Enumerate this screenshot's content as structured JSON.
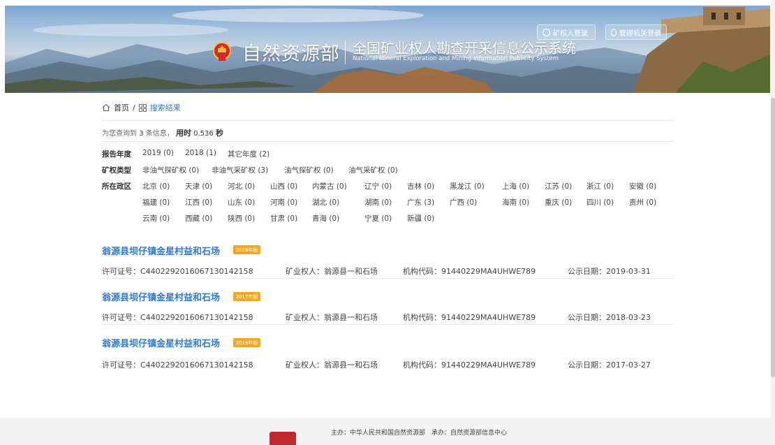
{
  "header": {
    "brand_name": "自然资源部",
    "system_title": "全国矿业权人勘查开采信息公示系统",
    "system_title_en": "National Mineral Exploration and Mining Information Publicity System",
    "miner_login": "矿权人登录",
    "admin_login": "管理机关登录"
  },
  "breadcrumb": {
    "home": "首页",
    "separator": "/",
    "current": "搜索结果"
  },
  "summary": {
    "prefix": "为您查询到",
    "count": "3",
    "unit": "条信息，",
    "time_label": "用时",
    "time_value": "0.536",
    "time_unit": "秒"
  },
  "filters": {
    "year": {
      "label": "报告年度",
      "options": [
        "2019 (0)",
        "2018 (1)",
        "其它年度 (2)"
      ]
    },
    "type": {
      "label": "矿权类型",
      "options": [
        "非油气探矿权 (0)",
        "非油气采矿权 (3)",
        "油气探矿权 (0)",
        "油气采矿权 (0)"
      ]
    },
    "region": {
      "label": "所在政区",
      "options": [
        "北京 (0)",
        "天津 (0)",
        "河北 (0)",
        "山西 (0)",
        "内蒙古 (0)",
        "辽宁 (0)",
        "吉林 (0)",
        "黑龙江 (0)",
        "上海 (0)",
        "江苏 (0)",
        "浙江 (0)",
        "安徽 (0)",
        "福建 (0)",
        "江西 (0)",
        "山东 (0)",
        "河南 (0)",
        "湖北 (0)",
        "湖南 (0)",
        "广东 (3)",
        "广西 (0)",
        "海南 (0)",
        "重庆 (0)",
        "四川 (0)",
        "贵州 (0)",
        "云南 (0)",
        "西藏 (0)",
        "陕西 (0)",
        "甘肃 (0)",
        "青海 (0)",
        "宁夏 (0)",
        "新疆 (0)"
      ]
    }
  },
  "results": [
    {
      "title": "翁源县坝仔镇金星村益和石场",
      "badge": "2018年报",
      "license": "许可证号：C4402292016067130142158",
      "owner": "矿业权人：翁源县一和石场",
      "org_code": "机构代码：91440229MA4UHWE789",
      "date": "公示日期：2019-03-31"
    },
    {
      "title": "翁源县坝仔镇金星村益和石场",
      "badge": "2017年报",
      "license": "许可证号：C4402292016067130142158",
      "owner": "矿业权人：翁源县一和石场",
      "org_code": "机构代码：91440229MA4UHWE789",
      "date": "公示日期：2018-03-23"
    },
    {
      "title": "翁源县坝仔镇金星村益和石场",
      "badge": "2016年报",
      "license": "许可证号：C4402292016067130142158",
      "owner": "矿业权人：翁源县一和石场",
      "org_code": "机构代码：91440229MA4UHWE789",
      "date": "公示日期：2017-03-27"
    }
  ],
  "footer": {
    "line1": "主办：中华人民共和国自然资源部　承办：自然资源部信息中心"
  },
  "colors": {
    "link_blue": "#2c7bd8",
    "badge_orange": "#f5a623",
    "footer_logo_red": "#c0282d"
  }
}
